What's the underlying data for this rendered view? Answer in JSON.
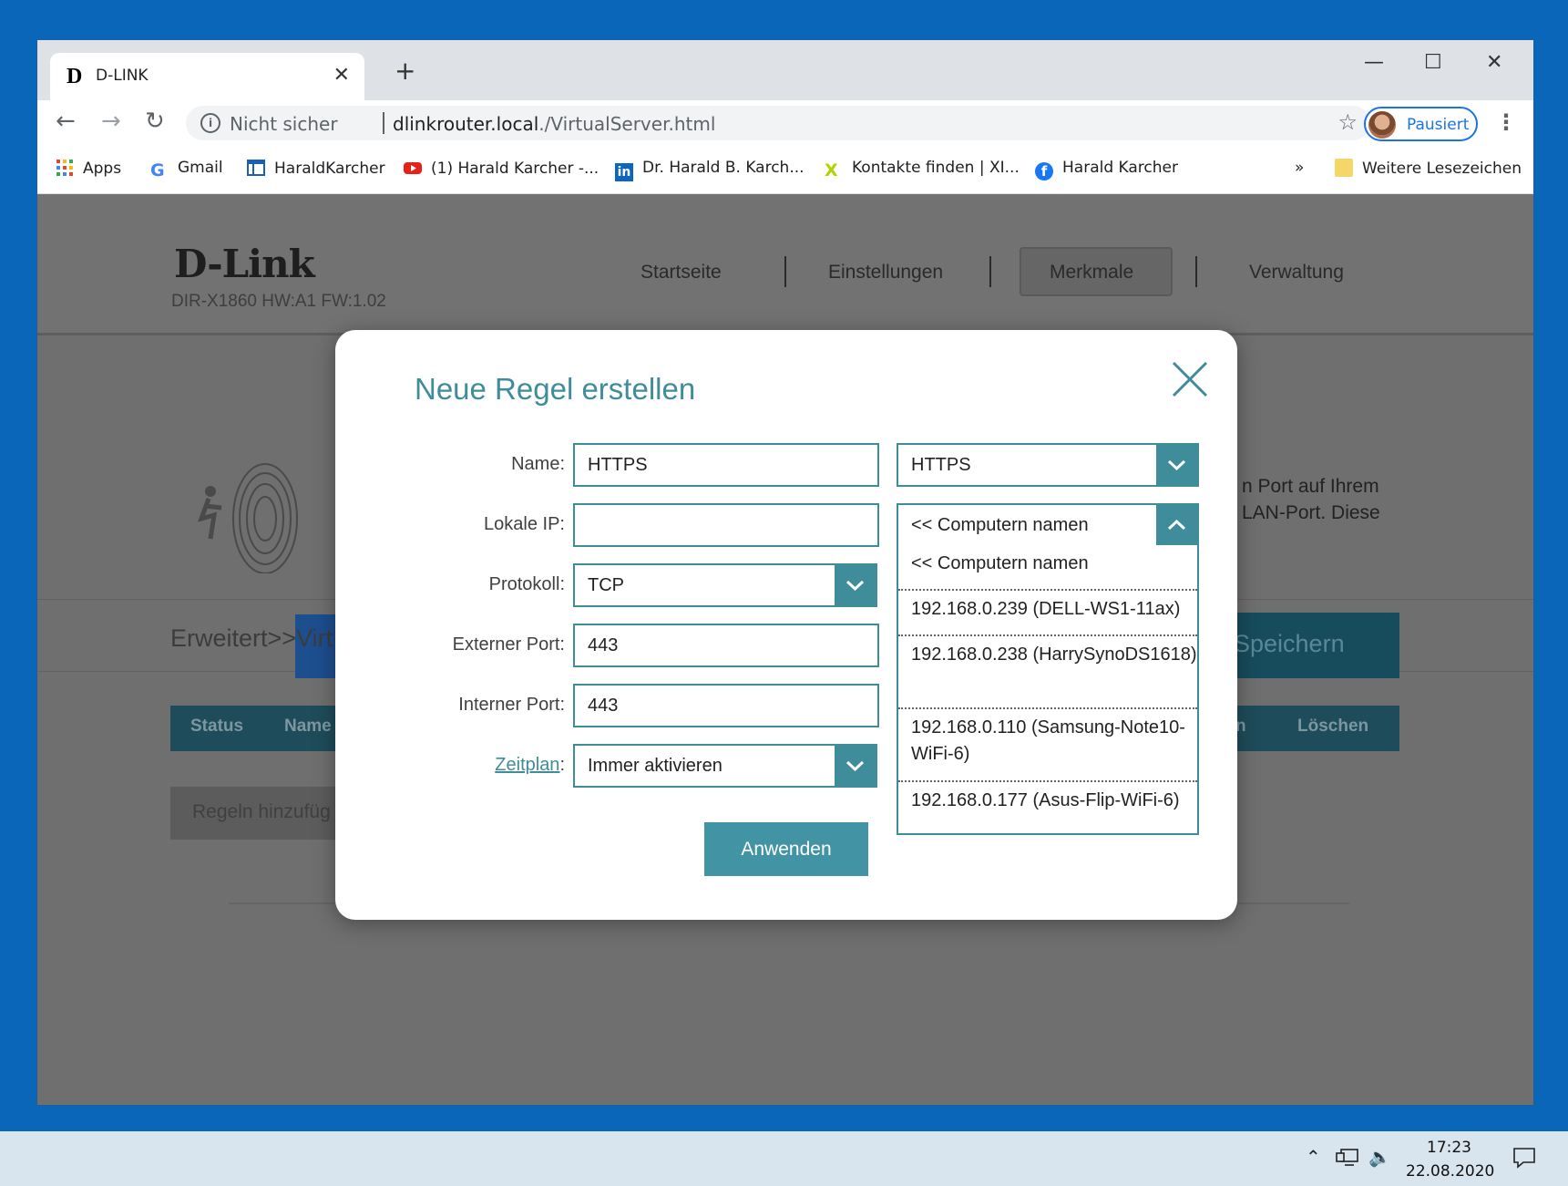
{
  "browser": {
    "tab_title": "D-LINK",
    "tab_favicon": "D",
    "new_tab": "+",
    "window_controls": {
      "minimize": "—",
      "maximize": "☐",
      "close": "✕"
    },
    "address": {
      "security": "Nicht sicher",
      "host": "dlinkrouter.local",
      "path": "./VirtualServer.html"
    },
    "profile_label": "Pausiert",
    "bookmarks": [
      {
        "label": "Apps",
        "icon": "apps-grid-icon"
      },
      {
        "label": "Gmail",
        "icon": "google-icon"
      },
      {
        "label": "HaraldKarcher",
        "icon": "page-icon"
      },
      {
        "label": "(1) Harald Karcher -...",
        "icon": "youtube-icon"
      },
      {
        "label": "Dr. Harald B. Karch...",
        "icon": "linkedin-icon"
      },
      {
        "label": "Kontakte finden | XI...",
        "icon": "xing-icon"
      },
      {
        "label": "Harald Karcher",
        "icon": "facebook-icon"
      }
    ],
    "bookmarks_overflow": "»",
    "other_bookmarks": "Weitere Lesezeichen"
  },
  "router": {
    "logo": "D-Link",
    "model": "DIR-X1860 HW:A1 FW:1.02",
    "nav": [
      "Startseite",
      "Einstellungen",
      "Merkmale",
      "Verwaltung"
    ],
    "active_nav": "Merkmale",
    "bg_description_line1": "n Port auf Ihrem",
    "bg_description_line2": "LAN-Port. Diese",
    "breadcrumb": "Erweitert>>Virt",
    "save_label": "Speichern",
    "table_headers": [
      "Status",
      "Name",
      "n",
      "Löschen"
    ],
    "add_rule": "Regeln hinzufüg"
  },
  "modal": {
    "title": "Neue Regel erstellen",
    "fields": {
      "name_label": "Name:",
      "name_value": "HTTPS",
      "name_preset": "HTTPS",
      "local_ip_label": "Lokale IP:",
      "local_ip_value": "",
      "computer_select": "<< Computern namen",
      "protocol_label": "Protokoll:",
      "protocol_value": "TCP",
      "external_port_label": "Externer Port:",
      "external_port_value": "443",
      "internal_port_label": "Interner Port:",
      "internal_port_value": "443",
      "schedule_label": "Zeitplan",
      "schedule_colon": ":",
      "schedule_value": "Immer aktivieren"
    },
    "apply_label": "Anwenden",
    "dropdown_options": [
      "<< Computern namen",
      "192.168.0.239 (DELL-WS1-11ax)",
      "192.168.0.238 (HarrySynoDS1618)",
      "192.168.0.110 (Samsung-Note10-WiFi-6)",
      "192.168.0.177 (Asus-Flip-WiFi-6)"
    ],
    "accent_color": "#3f8c9a"
  },
  "taskbar": {
    "time": "17:23",
    "date": "22.08.2020"
  }
}
